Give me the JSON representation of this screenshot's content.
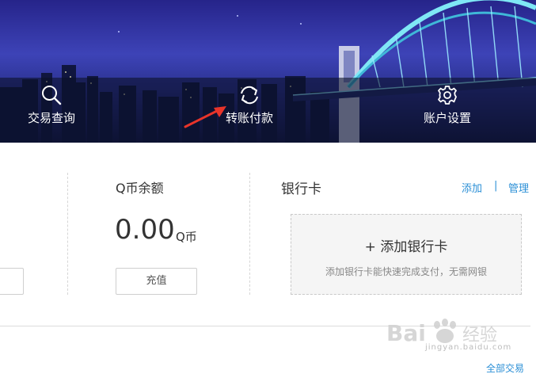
{
  "nav": {
    "items": [
      {
        "label": "交易查询",
        "icon": "search-icon"
      },
      {
        "label": "转账付款",
        "icon": "refresh-icon"
      },
      {
        "label": "账户设置",
        "icon": "gear-icon"
      }
    ]
  },
  "qcoin": {
    "title": "Q币余额",
    "amount": "0.00",
    "unit": "Q币",
    "recharge_label": "充值"
  },
  "bank_card": {
    "title": "银行卡",
    "add_link": "添加",
    "separator": "|",
    "manage_link": "管理",
    "add_card_title": "+ 添加银行卡",
    "add_card_desc": "添加银行卡能快速完成支付，无需网银"
  },
  "footer": {
    "all_trades_link": "全部交易"
  },
  "watermark": {
    "text": "jingyan.baidu.com"
  },
  "colors": {
    "link": "#2b8fd6",
    "banner_top": "#26248a",
    "annotation_arrow": "#e8342a"
  }
}
